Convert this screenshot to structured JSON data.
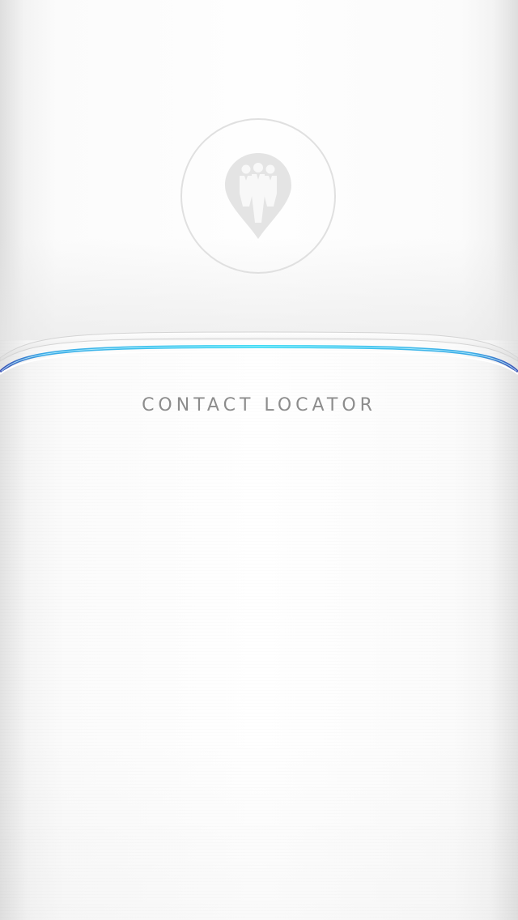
{
  "app": {
    "title": "CONTACT LOCATOR",
    "logo_icon": "contacts-location-pin-icon"
  },
  "colors": {
    "background": "#f7f7f7",
    "accent_glow": "#3fd6f0",
    "accent_dark": "#4a5fc2",
    "logo_gray": "#e4e4e4",
    "title_gray": "#8c8c8c"
  }
}
